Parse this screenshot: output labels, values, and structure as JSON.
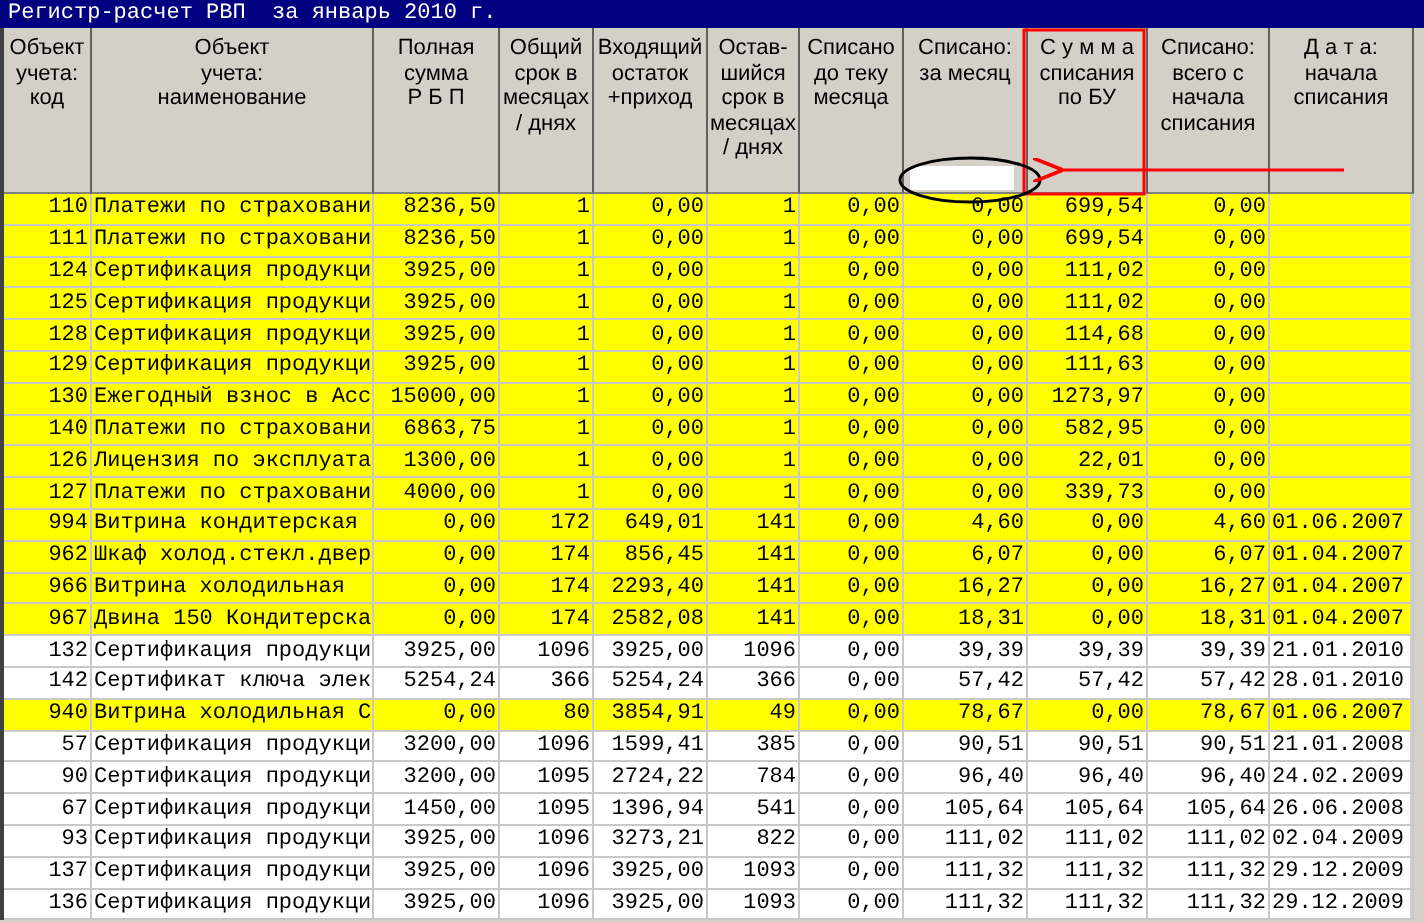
{
  "window": {
    "title": "Регистр-расчет РВП  за январь 2010 г."
  },
  "table": {
    "columns": [
      "Объект\nучета:\nкод",
      "Объект\nучета:\nнаименование",
      "Полная\nсумма\nР Б П",
      "Общий\nсрок в\nмесяцах\n/ днях",
      "Входящий\nостаток\n+приход",
      "Остав-\nшийся\nсрок в\nмесяцах\n/ днях",
      "Списано\nдо теку\nмесяца",
      "Списано:\nза месяц",
      "С у м м а\nсписания\nпо БУ",
      "Списано:\nвсего с\nначала\nсписания",
      "Д а т а:\nначала\nсписания"
    ],
    "rows": [
      {
        "highlighted": true,
        "cells": [
          "110",
          "Платежи по страховани",
          "8236,50",
          "1",
          "0,00",
          "1",
          "0,00",
          "0,00",
          "699,54",
          "0,00"
        ]
      },
      {
        "highlighted": true,
        "cells": [
          "111",
          "Платежи по страховани",
          "8236,50",
          "1",
          "0,00",
          "1",
          "0,00",
          "0,00",
          "699,54",
          "0,00"
        ]
      },
      {
        "highlighted": true,
        "cells": [
          "124",
          "Сертификация продукци",
          "3925,00",
          "1",
          "0,00",
          "1",
          "0,00",
          "0,00",
          "111,02",
          "0,00"
        ]
      },
      {
        "highlighted": true,
        "cells": [
          "125",
          "Сертификация продукци",
          "3925,00",
          "1",
          "0,00",
          "1",
          "0,00",
          "0,00",
          "111,02",
          "0,00"
        ]
      },
      {
        "highlighted": true,
        "cells": [
          "128",
          "Сертификация продукци",
          "3925,00",
          "1",
          "0,00",
          "1",
          "0,00",
          "0,00",
          "114,68",
          "0,00"
        ]
      },
      {
        "highlighted": true,
        "cells": [
          "129",
          "Сертификация продукци",
          "3925,00",
          "1",
          "0,00",
          "1",
          "0,00",
          "0,00",
          "111,63",
          "0,00"
        ]
      },
      {
        "highlighted": true,
        "cells": [
          "130",
          "Ежегодный взнос в Асс",
          "15000,00",
          "1",
          "0,00",
          "1",
          "0,00",
          "0,00",
          "1273,97",
          "0,00"
        ]
      },
      {
        "highlighted": true,
        "cells": [
          "140",
          "Платежи по страховани",
          "6863,75",
          "1",
          "0,00",
          "1",
          "0,00",
          "0,00",
          "582,95",
          "0,00"
        ]
      },
      {
        "highlighted": true,
        "cells": [
          "126",
          "Лицензия по эксплуата",
          "1300,00",
          "1",
          "0,00",
          "1",
          "0,00",
          "0,00",
          "22,01",
          "0,00"
        ]
      },
      {
        "highlighted": true,
        "cells": [
          "127",
          "Платежи по страховани",
          "4000,00",
          "1",
          "0,00",
          "1",
          "0,00",
          "0,00",
          "339,73",
          "0,00"
        ]
      },
      {
        "highlighted": true,
        "cells": [
          "994",
          "Витрина кондитерская",
          "0,00",
          "172",
          "649,01",
          "141",
          "0,00",
          "4,60",
          "0,00",
          "4,60",
          "01.06.2007"
        ]
      },
      {
        "highlighted": true,
        "cells": [
          "962",
          "Шкаф холод.стекл.двер",
          "0,00",
          "174",
          "856,45",
          "141",
          "0,00",
          "6,07",
          "0,00",
          "6,07",
          "01.04.2007"
        ]
      },
      {
        "highlighted": true,
        "cells": [
          "966",
          "Витрина холодильная",
          "0,00",
          "174",
          "2293,40",
          "141",
          "0,00",
          "16,27",
          "0,00",
          "16,27",
          "01.04.2007"
        ]
      },
      {
        "highlighted": true,
        "cells": [
          "967",
          "Двина 150 Кондитерска",
          "0,00",
          "174",
          "2582,08",
          "141",
          "0,00",
          "18,31",
          "0,00",
          "18,31",
          "01.04.2007"
        ]
      },
      {
        "highlighted": false,
        "cells": [
          "132",
          "Сертификация продукци",
          "3925,00",
          "1096",
          "3925,00",
          "1096",
          "0,00",
          "39,39",
          "39,39",
          "39,39",
          "21.01.2010"
        ]
      },
      {
        "highlighted": false,
        "cells": [
          "142",
          "Сертификат ключа элек",
          "5254,24",
          "366",
          "5254,24",
          "366",
          "0,00",
          "57,42",
          "57,42",
          "57,42",
          "28.01.2010"
        ]
      },
      {
        "highlighted": true,
        "cells": [
          "940",
          "Витрина холодильная С",
          "0,00",
          "80",
          "3854,91",
          "49",
          "0,00",
          "78,67",
          "0,00",
          "78,67",
          "01.06.2007"
        ]
      },
      {
        "highlighted": false,
        "cells": [
          "57",
          "Сертификация продукци",
          "3200,00",
          "1096",
          "1599,41",
          "385",
          "0,00",
          "90,51",
          "90,51",
          "90,51",
          "21.01.2008"
        ]
      },
      {
        "highlighted": false,
        "cells": [
          "90",
          "Сертификация продукци",
          "3200,00",
          "1095",
          "2724,22",
          "784",
          "0,00",
          "96,40",
          "96,40",
          "96,40",
          "24.02.2009"
        ]
      },
      {
        "highlighted": false,
        "cells": [
          "67",
          "Сертификация продукци",
          "1450,00",
          "1095",
          "1396,94",
          "541",
          "0,00",
          "105,64",
          "105,64",
          "105,64",
          "26.06.2008"
        ]
      },
      {
        "highlighted": false,
        "cells": [
          "93",
          "Сертификация продукци",
          "3925,00",
          "1096",
          "3273,21",
          "822",
          "0,00",
          "111,02",
          "111,02",
          "111,02",
          "02.04.2009"
        ]
      },
      {
        "highlighted": false,
        "cells": [
          "137",
          "Сертификация продукци",
          "3925,00",
          "1096",
          "3925,00",
          "1093",
          "0,00",
          "111,32",
          "111,32",
          "111,32",
          "29.12.2009"
        ]
      },
      {
        "highlighted": false,
        "cells": [
          "136",
          "Сертификация продукци",
          "3925,00",
          "1096",
          "3925,00",
          "1093",
          "0,00",
          "111,32",
          "111,32",
          "111,32",
          "29.12.2009"
        ]
      }
    ]
  }
}
